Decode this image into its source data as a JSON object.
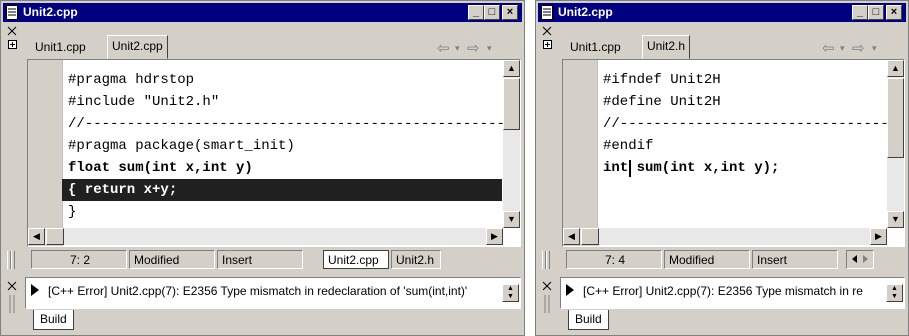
{
  "left": {
    "title": "Unit2.cpp",
    "tabs": [
      {
        "label": "Unit1.cpp",
        "active": false
      },
      {
        "label": "Unit2.cpp",
        "active": true
      }
    ],
    "code": [
      "#pragma hdrstop",
      "#include \"Unit2.h\"",
      "//-----------------------------------------------------",
      "#pragma package(smart_init)",
      "float sum(int x,int y)",
      "{ return x+y;",
      "}"
    ],
    "status": {
      "position": "7:  2",
      "modified": "Modified",
      "mode": "Insert",
      "file_tabs": [
        "Unit2.cpp",
        "Unit2.h"
      ]
    },
    "message": "[C++ Error] Unit2.cpp(7): E2356 Type mismatch in redeclaration of 'sum(int,int)'",
    "bottom_tab": "Build"
  },
  "right": {
    "title": "Unit2.cpp",
    "tabs": [
      {
        "label": "Unit1.cpp",
        "active": false
      },
      {
        "label": "Unit2.h",
        "active": true
      }
    ],
    "code": [
      "#ifndef Unit2H",
      "#define Unit2H",
      "//-----------------------------------------------------",
      "#endif",
      "int sum(int x,int y);"
    ],
    "status": {
      "position": "7:  4",
      "modified": "Modified",
      "mode": "Insert"
    },
    "message": "[C++ Error] Unit2.cpp(7): E2356 Type mismatch in re",
    "bottom_tab": "Build"
  },
  "title_buttons": {
    "minimize": "_",
    "maximize": "□",
    "close": "×"
  },
  "icons": {
    "file": "file-icon",
    "back": "arrow-left-icon",
    "forward": "arrow-right-icon"
  }
}
